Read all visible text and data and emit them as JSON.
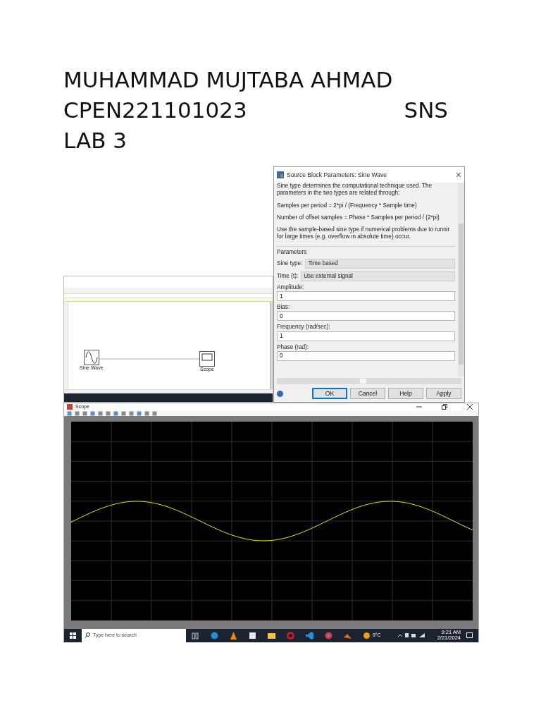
{
  "heading": {
    "name": "MUHAMMAD MUJTABA AHMAD",
    "id_number": "CPEN221101023",
    "course": "SNS",
    "lab": "LAB 3"
  },
  "model_window": {
    "blocks": [
      {
        "label": "Sine Wave",
        "kind": "sine"
      },
      {
        "label": "Scope",
        "kind": "scope"
      }
    ]
  },
  "dialog": {
    "title": "Source Block Parameters: Sine Wave",
    "close": "×",
    "description": [
      [
        "Sine type determines the computational technique used. The",
        "parameters in the two types are related through:"
      ],
      [
        "Samples per period = 2*pi / (Frequency * Sample time)"
      ],
      [
        "Number of offset samples = Phase * Samples per period / (2*pi)"
      ],
      [
        "Use the sample-based sine type if numerical problems due to runnir",
        "for large times (e.g. overflow in absolute time) occur."
      ]
    ],
    "group_label": "Parameters",
    "dropdowns": [
      {
        "label": "Sine type:",
        "value": "Time based"
      },
      {
        "label": "Time (t):",
        "value": "Use external signal"
      }
    ],
    "fields": [
      {
        "label": "Amplitude:",
        "value": "1"
      },
      {
        "label": "Bias:",
        "value": "0"
      },
      {
        "label": "Frequency (rad/sec):",
        "value": "1"
      },
      {
        "label": "Phase (rad):",
        "value": "0"
      }
    ],
    "buttons": [
      {
        "label": "OK",
        "default": true
      },
      {
        "label": "Cancel",
        "default": false
      },
      {
        "label": "Help",
        "default": false
      },
      {
        "label": "Apply",
        "default": false
      }
    ]
  },
  "scope_window": {
    "title": "Scope"
  },
  "taskbar": {
    "search_placeholder": "Type here to search",
    "weather": "9°C",
    "time": "9:21 AM",
    "date": "2/21/2024"
  }
}
